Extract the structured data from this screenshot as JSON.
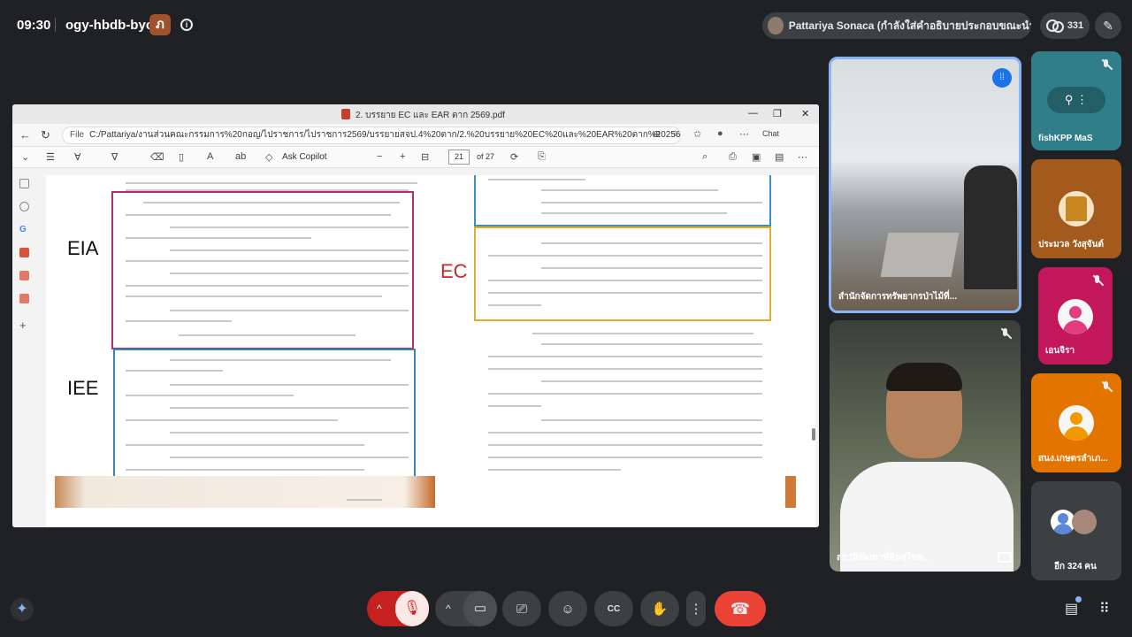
{
  "topbar": {
    "time": "09:30",
    "meeting_code": "ogy-hbdb-byc",
    "room_badge": "ภ",
    "presenter_text": "Pattariya Sonaca (กำลังใส่คำอธิบายประกอบขณะนำเสนอ)",
    "participant_count": "331"
  },
  "pdf": {
    "file_title": "2. บรรยาย EC และ EAR ตาก 2569.pdf",
    "url_label": "File",
    "url": "C:/Pattariya/งานส่วนคณะกรรมการ%20กอญ/ไปราชการ/ไปราชการ2569/บรรยายสจป.4%20ตาก/2.%20บรรยาย%20EC%20และ%20EAR%20ตาก%20256...",
    "chat_label": "Chat",
    "ask_copilot": "Ask Copilot",
    "page_current": "21",
    "page_total": "of 27",
    "tag_eia": "EIA",
    "tag_iee": "IEE",
    "tag_ec": "EC"
  },
  "participants": [
    {
      "name": "สำนักจัดการทรัพยากรป่าไม้ที่...",
      "muted": false,
      "speaking": true
    },
    {
      "name": "สถานีพัฒนาที่ดินสุโขท...",
      "muted": true
    },
    {
      "name": "fishKPP MaS",
      "muted": true
    },
    {
      "name": "ประมวล วังสุจันต์",
      "muted": false
    },
    {
      "name": "เอนจิรา",
      "muted": true,
      "color": "#c2185b"
    },
    {
      "name": "สนง.เกษตรลำเภ...",
      "muted": true,
      "color": "#e37400"
    },
    {
      "name": "อีก 324 คน"
    }
  ],
  "colors": {
    "eia_box": "#b0306b",
    "iee_box": "#3b82b8",
    "ec_box_top": "#3b8fc2",
    "ec_box": "#e0ae2e",
    "end_call": "#ea4335",
    "background": "#202124"
  }
}
